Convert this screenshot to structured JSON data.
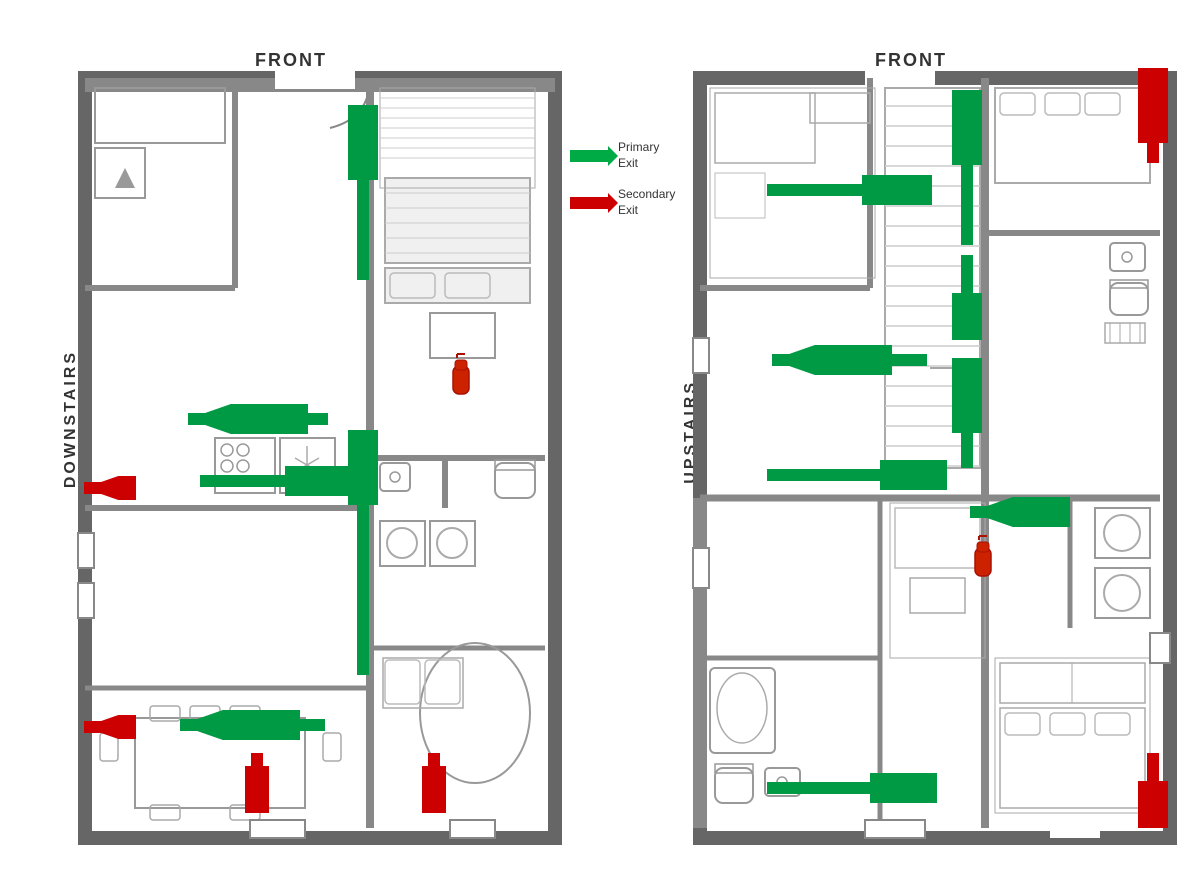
{
  "labels": {
    "front_left": "FRONT",
    "front_right": "FRONT",
    "downstairs": "DOWNSTAIRS",
    "upstairs": "UPSTAIRS",
    "primary_exit": "Primary\nExit",
    "secondary_exit": "Secondary\nExit"
  },
  "legend": {
    "primary_label": "Primary Exit",
    "secondary_label": "Secondary Exit"
  },
  "colors": {
    "wall": "#808080",
    "wall_thick": "#555555",
    "green_arrow": "#00aa44",
    "red_arrow": "#cc0000",
    "background": "#ffffff",
    "floor": "#f5f5f5"
  }
}
